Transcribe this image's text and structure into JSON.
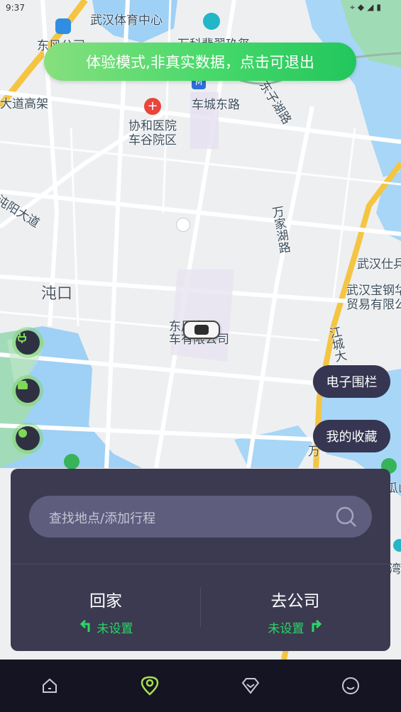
{
  "status_bar": {
    "time": "9:37",
    "icons": [
      "location-icon",
      "wifi-icon",
      "signal-icon",
      "battery-icon"
    ]
  },
  "banner": {
    "text": "体验模式,非真实数据，点击可退出"
  },
  "map": {
    "labels": {
      "stadium": "武汉体育中心",
      "east_wind": "东风公司",
      "vanke": "万科翡翠玖玺",
      "elevated": "大道高架",
      "chechengdong": "车城东路",
      "dongzihu": "东子湖路",
      "hospital": "协和医院\n车谷院区",
      "zhuanyang": "沌阳大道",
      "zhuankou": "沌口",
      "wanjiahu": "万家湖路",
      "dongfeng_auto": "东风汽\n车有限公司",
      "wuhan_shi": "武汉仕兵",
      "baosteel": "武汉宝钢华\n贸易有限公",
      "jiangcheng": "江城大",
      "wan": "万",
      "gua": "瓜山",
      "wan2": "湾"
    }
  },
  "buttons": {
    "geofence": "电子围栏",
    "favorites": "我的收藏"
  },
  "search": {
    "placeholder": "查找地点/添加行程"
  },
  "destinations": {
    "home": {
      "title": "回家",
      "status": "未设置"
    },
    "work": {
      "title": "去公司",
      "status": "未设置"
    }
  },
  "colors": {
    "accent": "#2bd766",
    "panel": "#3b3a50",
    "tabbar": "#141423",
    "banner_start": "#86e07e",
    "banner_end": "#22c65c"
  },
  "tabs": [
    {
      "name": "home",
      "icon": "home-icon",
      "active": false
    },
    {
      "name": "map",
      "icon": "location-pin-icon",
      "active": true
    },
    {
      "name": "discover",
      "icon": "diamond-icon",
      "active": false
    },
    {
      "name": "me",
      "icon": "smile-icon",
      "active": false
    }
  ]
}
